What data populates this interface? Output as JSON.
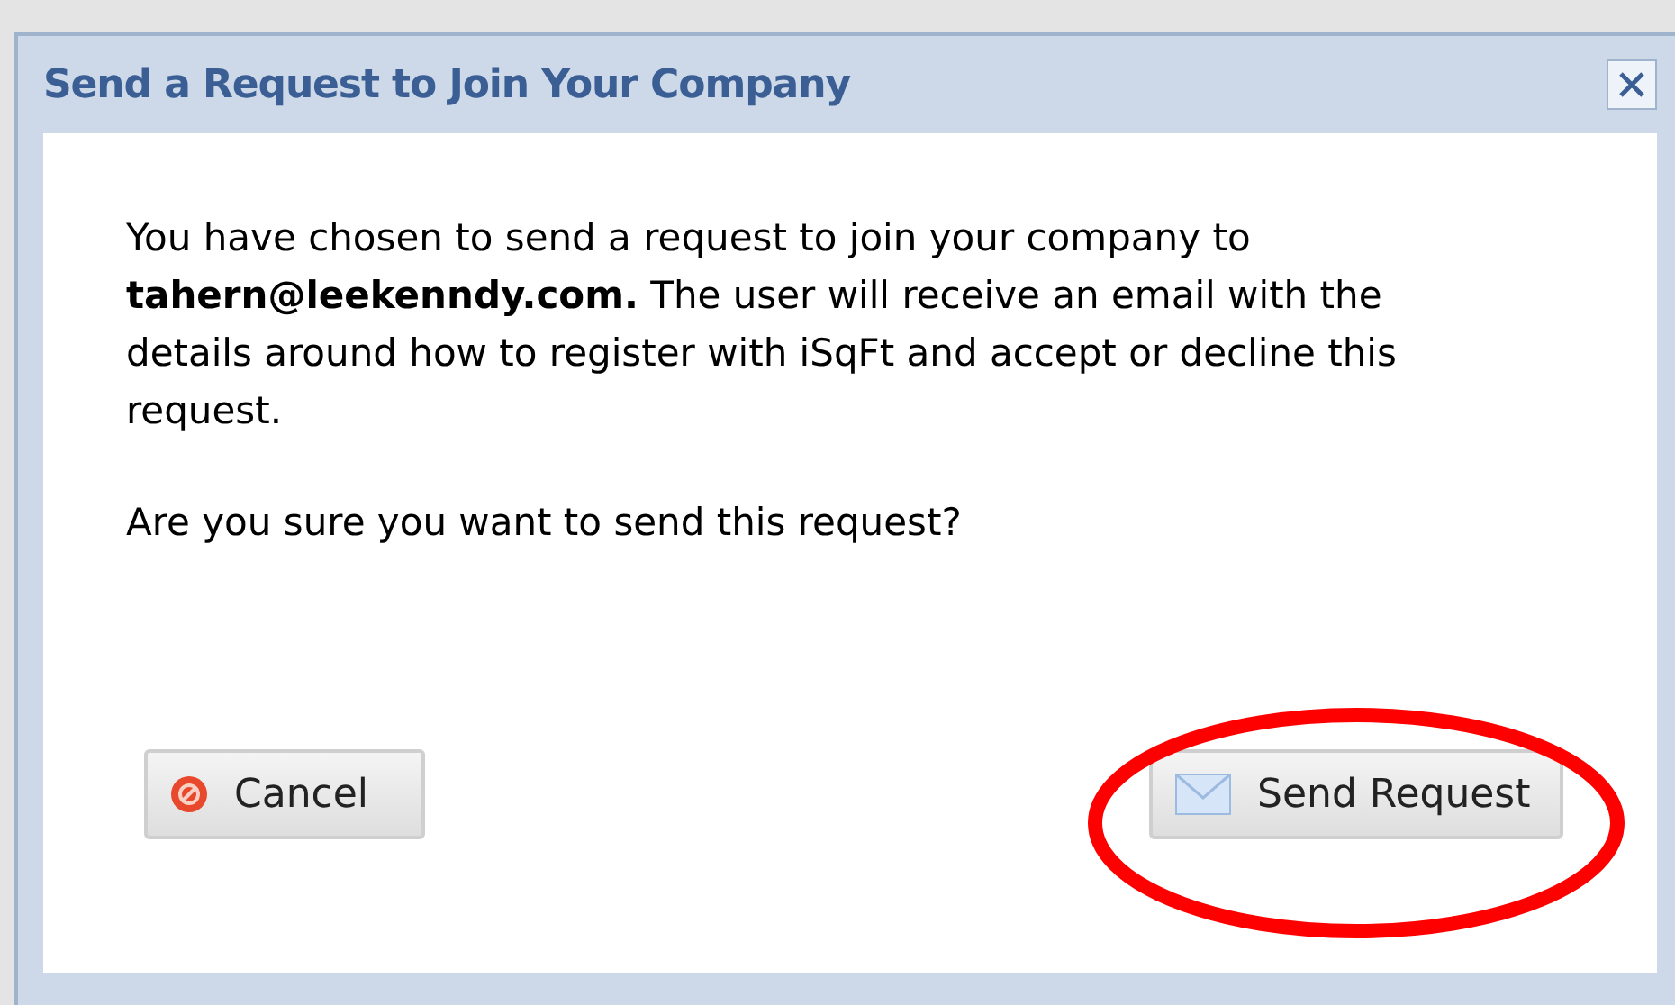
{
  "dialog": {
    "title": "Send a Request to Join Your Company",
    "message": "You have chosen to send a request to join your company to **tahern@leekenndy.com.** The user will receive an email with the details around how to register with iSqFt and accept or decline this request.",
    "question": "Are you sure you want to send this request?",
    "buttons": [
      {
        "label": "Cancel",
        "kind": "cancel"
      },
      {
        "label": "Send Request",
        "kind": "send"
      }
    ]
  }
}
